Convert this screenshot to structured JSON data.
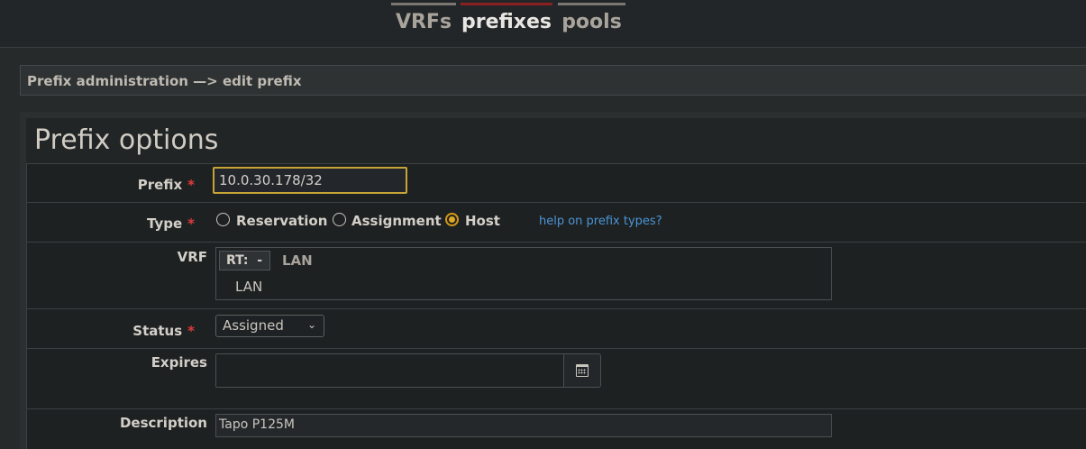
{
  "nav": {
    "tabs": [
      {
        "label": "VRFs",
        "active": false
      },
      {
        "label": "prefixes",
        "active": true
      },
      {
        "label": "pools",
        "active": false
      }
    ]
  },
  "breadcrumb": "Prefix administration —> edit prefix",
  "panel": {
    "title": "Prefix options"
  },
  "form": {
    "prefix": {
      "label": "Prefix",
      "value": "10.0.30.178/32",
      "required": "*"
    },
    "type": {
      "label": "Type",
      "required": "*",
      "options": [
        "Reservation",
        "Assignment",
        "Host"
      ],
      "selected": "Host",
      "help_link": "help on prefix types?"
    },
    "vrf": {
      "label": "VRF",
      "rt_label": "RT:",
      "rt_value": "-",
      "name": "LAN",
      "description": "LAN"
    },
    "status": {
      "label": "Status",
      "required": "*",
      "value": "Assigned"
    },
    "expires": {
      "label": "Expires",
      "value": ""
    },
    "description": {
      "label": "Description",
      "value": "Tapo P125M"
    }
  },
  "colors": {
    "accent_active_tab": "#8a2020",
    "required": "#e03b3b",
    "focus_border": "#c7a436",
    "link": "#4b95d6"
  },
  "icons": {
    "calendar": "calendar-icon",
    "dropdown": "chevron-down-icon"
  }
}
